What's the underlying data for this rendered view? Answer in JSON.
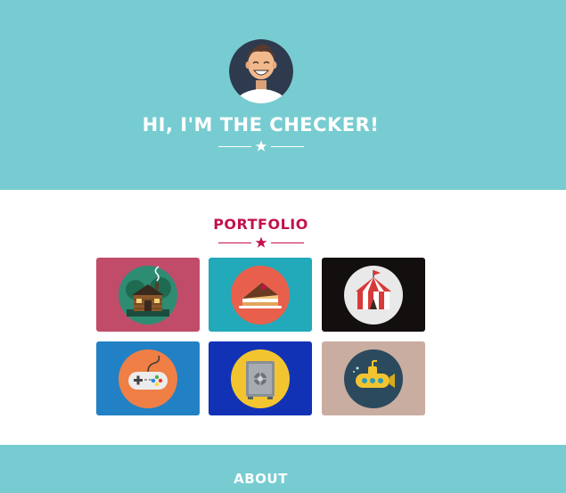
{
  "hero": {
    "title": "HI, I'M THE CHECKER!",
    "background": "#77ccd1",
    "avatar_icon": "smiling-person-avatar-icon"
  },
  "portfolio": {
    "title": "PORTFOLIO",
    "accent": "#c3124b",
    "items": [
      {
        "icon": "log-cabin-icon",
        "tile_color": "#c04c6a"
      },
      {
        "icon": "cake-slice-icon",
        "tile_color": "#22a9ba"
      },
      {
        "icon": "circus-tent-icon",
        "tile_color": "#130f0e"
      },
      {
        "icon": "game-controller-icon",
        "tile_color": "#2281c4"
      },
      {
        "icon": "safe-icon",
        "tile_color": "#1232b6"
      },
      {
        "icon": "submarine-icon",
        "tile_color": "#c9ada0"
      }
    ]
  },
  "about": {
    "title": "ABOUT"
  }
}
